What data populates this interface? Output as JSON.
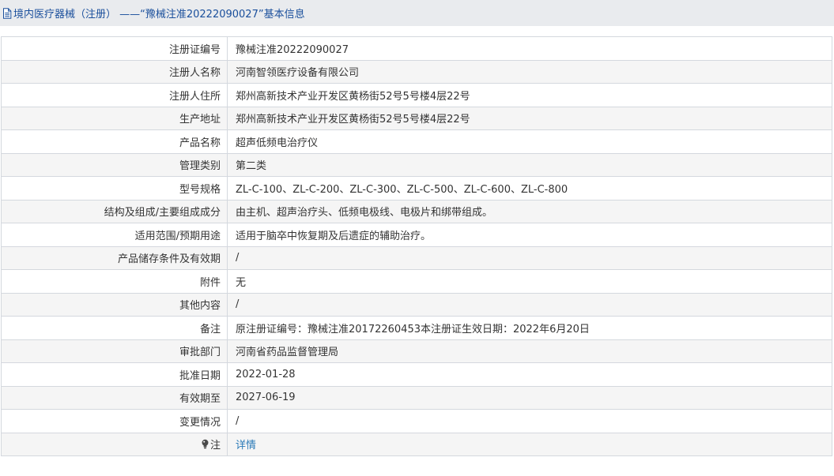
{
  "header": {
    "title": "境内医疗器械（注册） ——“豫械注准20222090027”基本信息",
    "icon": "document-icon"
  },
  "rows": [
    {
      "label": "注册证编号",
      "value": "豫械注准20222090027"
    },
    {
      "label": "注册人名称",
      "value": "河南智领医疗设备有限公司"
    },
    {
      "label": "注册人住所",
      "value": "郑州高新技术产业开发区黄杨街52号5号楼4层22号"
    },
    {
      "label": "生产地址",
      "value": "郑州高新技术产业开发区黄杨街52号5号楼4层22号"
    },
    {
      "label": "产品名称",
      "value": "超声低频电治疗仪"
    },
    {
      "label": "管理类别",
      "value": "第二类"
    },
    {
      "label": "型号规格",
      "value": "ZL-C-100、ZL-C-200、ZL-C-300、ZL-C-500、ZL-C-600、ZL-C-800"
    },
    {
      "label": "结构及组成/主要组成成分",
      "value": "由主机、超声治疗头、低频电极线、电极片和绑带组成。"
    },
    {
      "label": "适用范围/预期用途",
      "value": "适用于脑卒中恢复期及后遗症的辅助治疗。"
    },
    {
      "label": "产品储存条件及有效期",
      "value": "/"
    },
    {
      "label": "附件",
      "value": "无"
    },
    {
      "label": "其他内容",
      "value": "/"
    },
    {
      "label": "备注",
      "value": "原注册证编号：豫械注准20172260453本注册证生效日期：2022年6月20日"
    },
    {
      "label": "审批部门",
      "value": "河南省药品监督管理局"
    },
    {
      "label": "批准日期",
      "value": "2022-01-28"
    },
    {
      "label": "有效期至",
      "value": "2027-06-19"
    },
    {
      "label": "变更情况",
      "value": "/"
    }
  ],
  "note": {
    "label": "注",
    "icon": "lightbulb-icon",
    "link_text": "详情"
  },
  "colors": {
    "header_bg": "#e9ebee",
    "header_text": "#1a4f9c",
    "link": "#2a7ab8",
    "border": "#d4d8de",
    "alt_row": "#f5f5f5"
  }
}
